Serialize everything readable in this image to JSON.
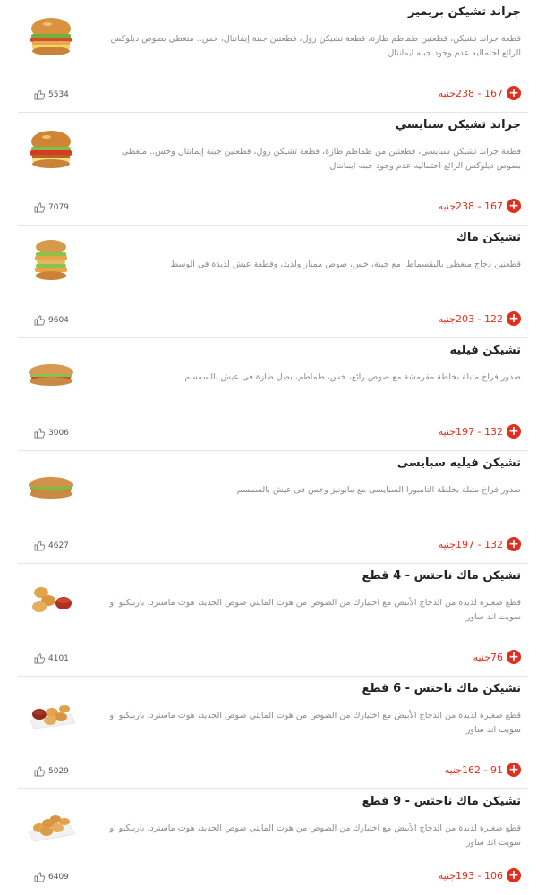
{
  "items": [
    {
      "title": "جراند تشيكن بريمير",
      "description": "قطعة جراند تشيكن، قطعتين طماطم طازة، قطعة تشيكن رول، قطعتين جبنة إيمانتال، خس.. متغطي بصوص ديلوكس الرائع احتماليه عدم وجود جبنه ايمانتال",
      "price": "167 - 238جنيه",
      "likes": "5534",
      "image": "burger-premier",
      "image_icon": "burger-image"
    },
    {
      "title": "جراند تشيكن سبايسي",
      "description": "قطعة جراند تشيكن سبايسي، قطعتين من طماطم طازة، قطعة تشيكن رول، قطعتين جبنة إيمانتال وخس.. متغطى بصوص ديلوكس الرائع احتماليه عدم وجود جبنه ايمانتال",
      "price": "167 - 238جنيه",
      "likes": "7079",
      "image": "burger-spicy",
      "image_icon": "burger-image"
    },
    {
      "title": "تشيكن ماك",
      "description": "قطعتين دجاج متغطى بالبقسماط، مع جبنة، خس، صوص ممتاز ولذيذ، وقطعة عيش لذيذة فى الوسط",
      "price": "122 - 203جنيه",
      "likes": "9604",
      "image": "chicken-mac",
      "image_icon": "burger-image"
    },
    {
      "title": "تشيكن فيليه",
      "description": "صدور فراخ متبلة بخلطة مقرمشة مع صوص رائع، خس، طماطم، بصل طازة فى عيش بالسمسم",
      "price": "132 - 197جنيه",
      "likes": "3006",
      "image": "sandwich",
      "image_icon": "sandwich-image"
    },
    {
      "title": "تشيكن فيليه سبايسى",
      "description": "صدور فراخ متبلة بخلطة التامبورا السبايسى مع مايونيز وخس فى عيش بالسمسم",
      "price": "132 - 197جنيه",
      "likes": "4627",
      "image": "sandwich-spicy",
      "image_icon": "sandwich-image"
    },
    {
      "title": "تشيكن ماك ناجتس - 4 قطع",
      "description": "قطع صغيرة لذيذة من الدجاج الأبيض مع اختيارك من الصوص من هوت المايتي صوص الجديد، هوت ماسترد، باربيكيو او سويت اند ساور",
      "price": "76جنيه",
      "likes": "4101",
      "image": "nuggets-4",
      "image_icon": "nuggets-image"
    },
    {
      "title": "تشيكن ماك ناجتس - 6 قطع",
      "description": "قطع صغيرة لذيذة من الدجاج الأبيض مع اختيارك من الصوص من هوت المايتي صوص الجديد، هوت ماسترد، باربيكيو او سويت اند ساور",
      "price": "91 - 162جنيه",
      "likes": "5029",
      "image": "nuggets-6",
      "image_icon": "nuggets-image"
    },
    {
      "title": "تشيكن ماك ناجتس - 9 قطع",
      "description": "قطع صغيرة لذيذة من الدجاج الأبيض مع اختيارك من الصوص من هوت المايتي صوص الجديد، هوت ماسترد، باربيكيو او سويت اند ساور",
      "price": "106 - 193جنيه",
      "likes": "6409",
      "image": "nuggets-9",
      "image_icon": "nuggets-image"
    }
  ],
  "colors": {
    "accent": "#e42e1d",
    "title": "#222222",
    "description": "#8a8a8a",
    "divider": "#e6e6e6"
  },
  "icons": {
    "add": "plus-icon",
    "like": "thumbs-up-icon"
  }
}
